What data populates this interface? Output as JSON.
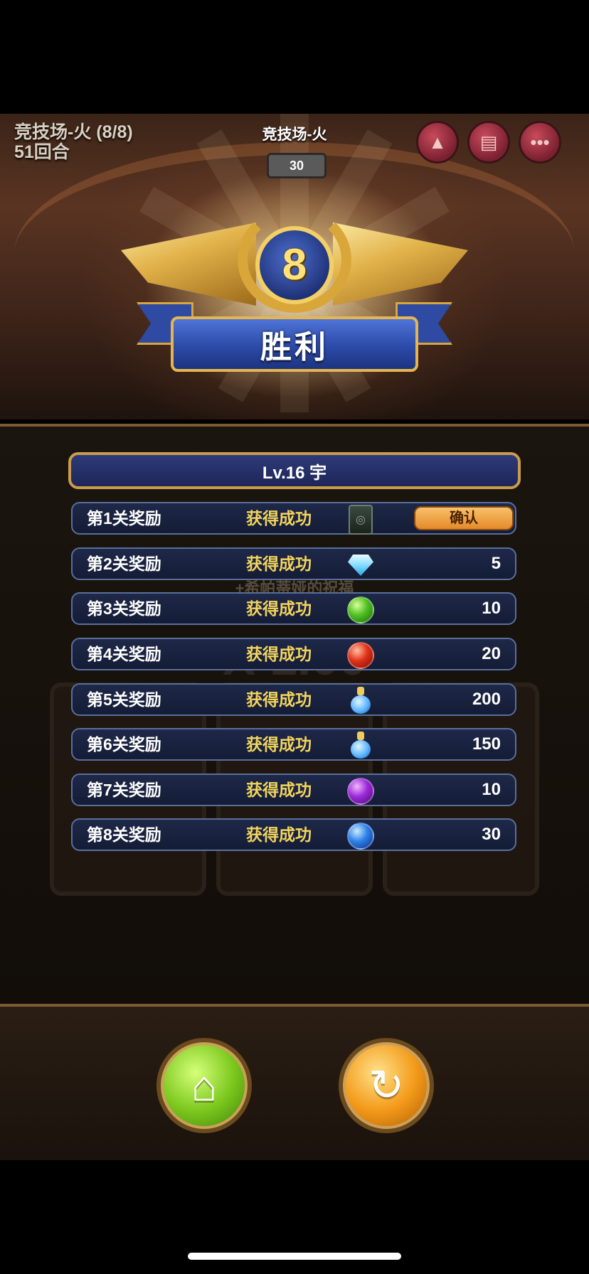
{
  "hud": {
    "stage": "竞技场-火 (8/8)",
    "rounds": "51回合",
    "title": "竞技场-火",
    "timer": "30"
  },
  "hud_buttons": [
    {
      "icon": "triangle-icon"
    },
    {
      "icon": "scroll-icon"
    },
    {
      "icon": "more-icon"
    }
  ],
  "victory": {
    "stage_number": "8",
    "label": "胜利"
  },
  "background_text": {
    "blessing": "+希帕蒂娅的祝福",
    "multiplier": "X 1.00"
  },
  "player": {
    "level_name": "Lv.16  宇"
  },
  "rewards": [
    {
      "label": "第1关奖励",
      "status": "获得成功",
      "icon": "card-icon",
      "count": null,
      "action": "确认"
    },
    {
      "label": "第2关奖励",
      "status": "获得成功",
      "icon": "diamond-icon",
      "count": "5"
    },
    {
      "label": "第3关奖励",
      "status": "获得成功",
      "icon": "green-orb-icon",
      "count": "10"
    },
    {
      "label": "第4关奖励",
      "status": "获得成功",
      "icon": "red-orb-icon",
      "count": "20"
    },
    {
      "label": "第5关奖励",
      "status": "获得成功",
      "icon": "potion-icon",
      "count": "200"
    },
    {
      "label": "第6关奖励",
      "status": "获得成功",
      "icon": "potion-icon",
      "count": "150"
    },
    {
      "label": "第7关奖励",
      "status": "获得成功",
      "icon": "purple-orb-icon",
      "count": "10"
    },
    {
      "label": "第8关奖励",
      "status": "获得成功",
      "icon": "blue-orb-icon",
      "count": "30"
    }
  ],
  "bottom": {
    "home_icon": "home-icon",
    "retry_icon": "retry-icon"
  },
  "colors": {
    "status_gold": "#f3d45c",
    "ribbon_blue": "#2c4aa8",
    "confirm_orange": "#e58a2a"
  }
}
